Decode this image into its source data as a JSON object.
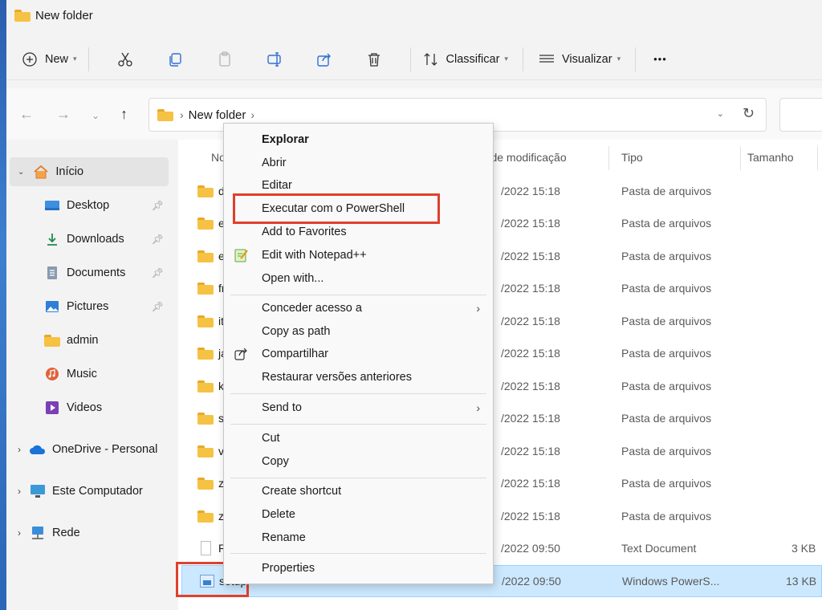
{
  "window": {
    "title": "New folder"
  },
  "toolbar": {
    "new_label": "New",
    "sort_label": "Classificar",
    "view_label": "Visualizar",
    "more_label": "•••"
  },
  "address": {
    "crumb": "New folder",
    "sep1": "›",
    "sep2": "›"
  },
  "sidebar": {
    "home": "Início",
    "items": [
      {
        "label": "Desktop"
      },
      {
        "label": "Downloads"
      },
      {
        "label": "Documents"
      },
      {
        "label": "Pictures"
      },
      {
        "label": "admin"
      },
      {
        "label": "Music"
      },
      {
        "label": "Videos"
      }
    ],
    "onedrive": "OneDrive - Personal",
    "thispc": "Este Computador",
    "network": "Rede"
  },
  "columns": {
    "name": "Nome",
    "date": "Data de modificação",
    "type": "Tipo",
    "size": "Tamanho"
  },
  "files": [
    {
      "name": "de",
      "date": "/2022 15:18",
      "type": "Pasta de arquivos",
      "size": ""
    },
    {
      "name": "en",
      "date": "/2022 15:18",
      "type": "Pasta de arquivos",
      "size": ""
    },
    {
      "name": "es",
      "date": "/2022 15:18",
      "type": "Pasta de arquivos",
      "size": ""
    },
    {
      "name": "fr-",
      "date": "/2022 15:18",
      "type": "Pasta de arquivos",
      "size": ""
    },
    {
      "name": "it-",
      "date": "/2022 15:18",
      "type": "Pasta de arquivos",
      "size": ""
    },
    {
      "name": "ja",
      "date": "/2022 15:18",
      "type": "Pasta de arquivos",
      "size": ""
    },
    {
      "name": "ko",
      "date": "/2022 15:18",
      "type": "Pasta de arquivos",
      "size": ""
    },
    {
      "name": "sv",
      "date": "/2022 15:18",
      "type": "Pasta de arquivos",
      "size": ""
    },
    {
      "name": "vn",
      "date": "/2022 15:18",
      "type": "Pasta de arquivos",
      "size": ""
    },
    {
      "name": "zh",
      "date": "/2022 15:18",
      "type": "Pasta de arquivos",
      "size": ""
    },
    {
      "name": "zh",
      "date": "/2022 15:18",
      "type": "Pasta de arquivos",
      "size": ""
    },
    {
      "name": "RE",
      "date": "/2022 09:50",
      "type": "Text Document",
      "size": "3 KB"
    },
    {
      "name": "setup",
      "date": "/2022 09:50",
      "type": "Windows PowerS...",
      "size": "13 KB"
    }
  ],
  "context_menu": {
    "explorar": "Explorar",
    "abrir": "Abrir",
    "editar": "Editar",
    "powershell": "Executar com o PowerShell",
    "favorites": "Add to Favorites",
    "notepad": "Edit with Notepad++",
    "openwith": "Open with...",
    "conceder": "Conceder acesso a",
    "copypath": "Copy as path",
    "compartilhar": "Compartilhar",
    "restaurar": "Restaurar versões anteriores",
    "sendto": "Send to",
    "cut": "Cut",
    "copy": "Copy",
    "shortcut": "Create shortcut",
    "delete": "Delete",
    "rename": "Rename",
    "properties": "Properties"
  },
  "colors": {
    "highlight": "#e0402c",
    "selection": "#cce8ff",
    "folder": "#f6c243"
  }
}
